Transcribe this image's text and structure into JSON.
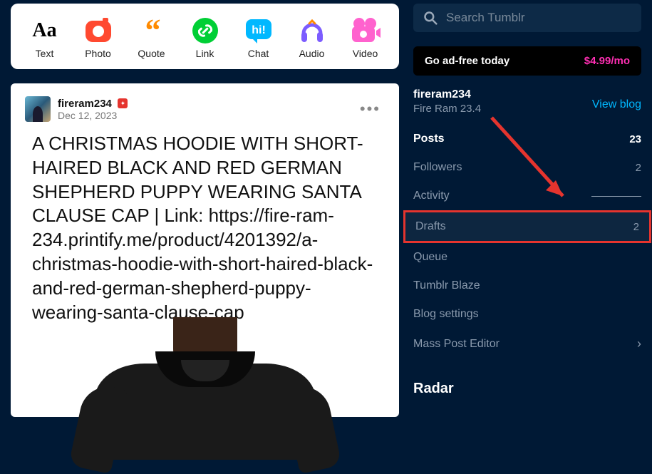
{
  "post_types": {
    "text": "Text",
    "photo": "Photo",
    "quote": "Quote",
    "link": "Link",
    "chat": "Chat",
    "audio": "Audio",
    "video": "Video"
  },
  "post": {
    "username": "fireram234",
    "date": "Dec 12, 2023",
    "body": "A CHRISTMAS HOODIE WITH SHORT-HAIRED BLACK AND RED GERMAN SHEPHERD PUPPY WEARING SANTA CLAUSE CAP | Link: https://fire-ram-234.printify.me/product/4201392/a-christmas-hoodie-with-short-haired-black-and-red-german-shepherd-puppy-wearing-santa-clause-cap"
  },
  "search": {
    "placeholder": "Search Tumblr"
  },
  "adfree": {
    "text": "Go ad-free today",
    "price": "$4.99/mo"
  },
  "profile": {
    "name": "fireram234",
    "sub": "Fire Ram 23.4",
    "view": "View blog"
  },
  "nav": {
    "posts": {
      "label": "Posts",
      "count": "23"
    },
    "followers": {
      "label": "Followers",
      "count": "2"
    },
    "activity": {
      "label": "Activity"
    },
    "drafts": {
      "label": "Drafts",
      "count": "2"
    },
    "queue": {
      "label": "Queue"
    },
    "blaze": {
      "label": "Tumblr Blaze"
    },
    "settings": {
      "label": "Blog settings"
    },
    "mass": {
      "label": "Mass Post Editor"
    }
  },
  "radar": {
    "title": "Radar"
  }
}
